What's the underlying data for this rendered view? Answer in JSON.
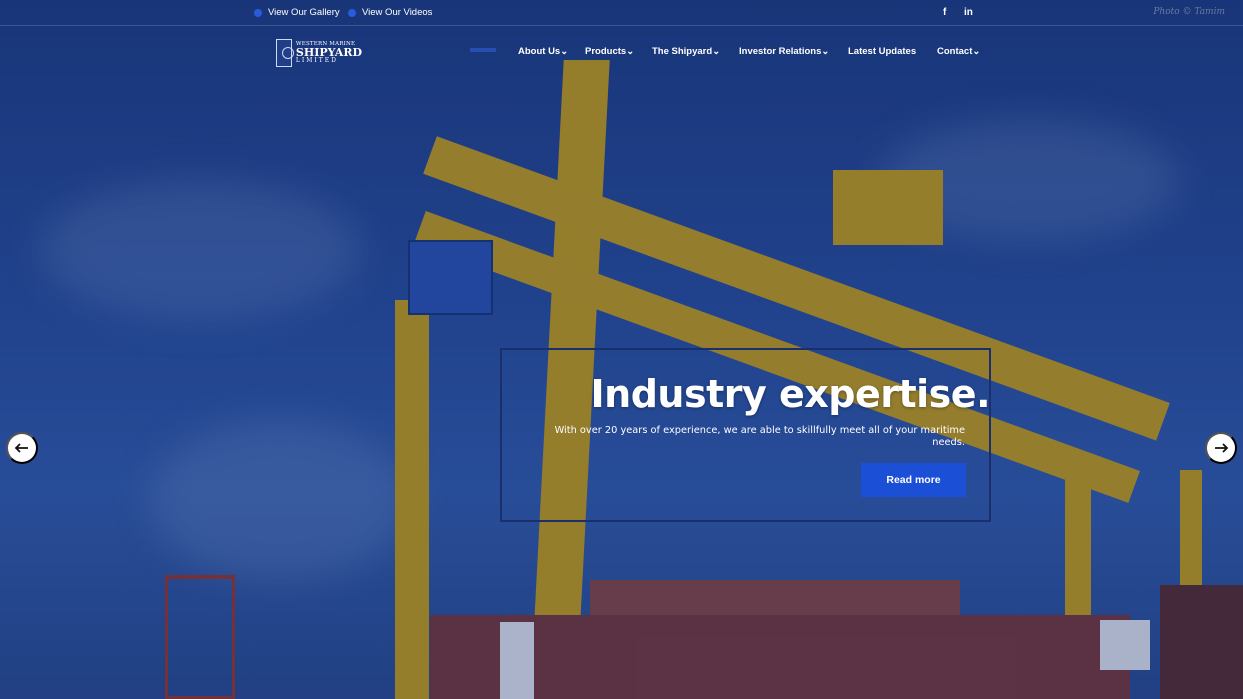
{
  "topbar": {
    "gallery_label": "View Our Gallery",
    "videos_label": "View Our Videos",
    "facebook_glyph": "f",
    "linkedin_glyph": "in",
    "watermark": "Photo © Tamim"
  },
  "logo": {
    "line1": "WESTERN MARINE",
    "line2": "SHIPYARD",
    "line3": "LIMITED"
  },
  "nav": {
    "items": [
      {
        "label": "About Us",
        "has_dropdown": true
      },
      {
        "label": "Products",
        "has_dropdown": true
      },
      {
        "label": "The Shipyard",
        "has_dropdown": true
      },
      {
        "label": "Investor Relations",
        "has_dropdown": true
      },
      {
        "label": "Latest Updates",
        "has_dropdown": false
      },
      {
        "label": "Contact",
        "has_dropdown": true
      }
    ],
    "dropdown_glyph": "⌄"
  },
  "hero": {
    "headline": "Industry expertise.",
    "subtext": "With over 20 years of experience, we are able to skillfully meet all of your maritime needs.",
    "cta_label": "Read more"
  },
  "slider": {
    "prev_icon": "arrow-left-icon",
    "next_icon": "arrow-right-icon"
  },
  "colors": {
    "accent": "#1b4fd6",
    "crane_yellow": "#c9a21a",
    "sky_blue": "#2a52a2"
  }
}
